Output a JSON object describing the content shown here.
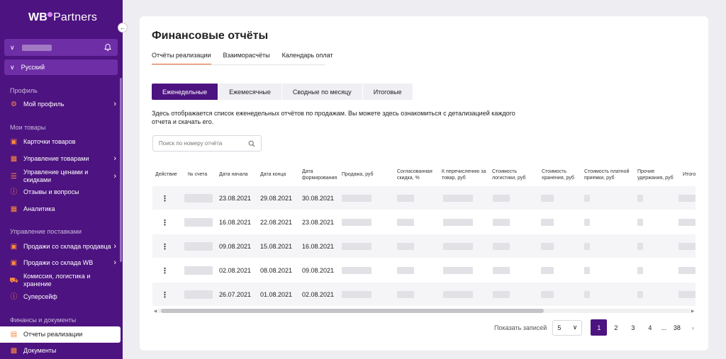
{
  "brand": {
    "logo_wb": "WB",
    "logo_partners": "Partners"
  },
  "sidebar": {
    "language": "Русский",
    "sections": {
      "profile": "Профиль",
      "goods": "Мои товары",
      "supply": "Управление поставками",
      "finance": "Финансы и документы"
    },
    "items": [
      {
        "label": "Мой профиль",
        "icon": "gear-icon"
      },
      {
        "label": "Карточки товаров",
        "icon": "box-icon"
      },
      {
        "label": "Управление товарами",
        "icon": "boxes-icon"
      },
      {
        "label": "Управление ценами и скидками",
        "icon": "tags-icon"
      },
      {
        "label": "Отзывы и вопросы",
        "icon": "question-icon"
      },
      {
        "label": "Аналитика",
        "icon": "chart-icon"
      },
      {
        "label": "Продажи со склада продавца",
        "icon": "warehouse-icon"
      },
      {
        "label": "Продажи со склада WB",
        "icon": "warehouse-icon"
      },
      {
        "label": "Комиссия, логистика и хранение",
        "icon": "truck-icon"
      },
      {
        "label": "Суперсейф",
        "icon": "info-icon"
      },
      {
        "label": "Отчеты реализации",
        "icon": "document-icon"
      },
      {
        "label": "Документы",
        "icon": "briefcase-icon"
      }
    ]
  },
  "main": {
    "title": "Финансовые отчёты",
    "tabs": [
      "Отчёты реализации",
      "Взаиморасчёты",
      "Календарь оплат"
    ],
    "periods": [
      "Еженедельные",
      "Ежемесячные",
      "Сводные по месяцу",
      "Итоговые"
    ],
    "description": "Здесь отображается список еженедельных отчётов по продажам. Вы можете здесь ознакомиться с детализацией каждого отчета и скачать его.",
    "search_placeholder": "Поиск по номеру отчёта",
    "columns": [
      "Действие",
      "№ счета",
      "Дата начала",
      "Дата конца",
      "Дата формирования",
      "Продажа, руб",
      "Согласованная скидка, %",
      "К перечислению за товар, руб",
      "Стоимость логистики, руб",
      "Стоимость хранения, руб",
      "Стоимость платной приемки, руб",
      "Прочие удержания, руб",
      "Итого"
    ],
    "rows": [
      {
        "start": "23.08.2021",
        "end": "29.08.2021",
        "formed": "30.08.2021"
      },
      {
        "start": "16.08.2021",
        "end": "22.08.2021",
        "formed": "23.08.2021"
      },
      {
        "start": "09.08.2021",
        "end": "15.08.2021",
        "formed": "16.08.2021"
      },
      {
        "start": "02.08.2021",
        "end": "08.08.2021",
        "formed": "09.08.2021"
      },
      {
        "start": "26.07.2021",
        "end": "01.08.2021",
        "formed": "02.08.2021"
      }
    ],
    "pagination": {
      "label": "Показать записей",
      "per_page": "5",
      "pages": [
        "1",
        "2",
        "3",
        "4"
      ],
      "ellipsis": "...",
      "last": "38"
    }
  },
  "colors": {
    "brand": "#4d1380",
    "accent": "#f26c36"
  }
}
